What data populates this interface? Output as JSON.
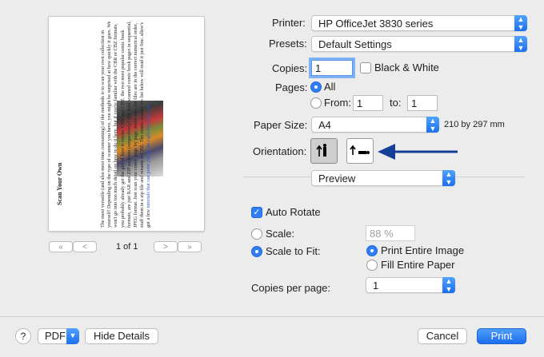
{
  "preview": {
    "doc_title": "Scan Your Own",
    "body_text": "The most versatile (and also most time consuming) of the methods is to scan your own collection in yourself! Depending on the type of scanner you have, you might be surprised at how quickly it goes. We won't go into too much detail on how to do it here, but if you're familiar with the CBR or CBZ formats, you probably already get the gist of how it works. CBR and CBZ, the two most popular comic book formats, are just RAR and ZIP archives (respectively) that hold scanned comic book pages in sequential, JPEG format. Just scan your comic page by page, make sure the files are in the correct numerical order, stuff them in a zip file and rename it CBZ. The comic readers we list below will read it just fine. allow's got a few",
    "link_text": "tutorials that can point you in the right direction, see.",
    "page_indicator": "1 of 1",
    "nav": {
      "first": "«",
      "prev": "<",
      "next": ">",
      "last": "»"
    }
  },
  "printer": {
    "label": "Printer:",
    "value": "HP OfficeJet 3830 series"
  },
  "presets": {
    "label": "Presets:",
    "value": "Default Settings"
  },
  "copies": {
    "label": "Copies:",
    "value": "1",
    "bw_label": "Black & White"
  },
  "pages": {
    "label": "Pages:",
    "all_label": "All",
    "from_label": "From:",
    "from_value": "1",
    "to_label": "to:",
    "to_value": "1"
  },
  "paper_size": {
    "label": "Paper Size:",
    "value": "A4",
    "dimensions": "210 by 297 mm"
  },
  "orientation": {
    "label": "Orientation:"
  },
  "section": {
    "value": "Preview"
  },
  "auto_rotate": {
    "label": "Auto Rotate"
  },
  "scale": {
    "label": "Scale:",
    "value": "88 %",
    "fit_label": "Scale to Fit:",
    "print_entire": "Print Entire Image",
    "fill_entire": "Fill Entire Paper"
  },
  "copies_per_page": {
    "label": "Copies per page:",
    "value": "1"
  },
  "footer": {
    "help": "?",
    "pdf": "PDF",
    "hide_details": "Hide Details",
    "cancel": "Cancel",
    "print": "Print"
  },
  "colors": {
    "accent": "#1b6ef0",
    "arrow": "#153f97"
  }
}
